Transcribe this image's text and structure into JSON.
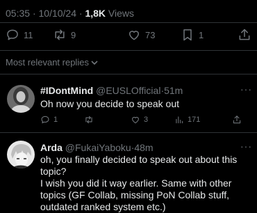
{
  "tweet": {
    "time": "05:35",
    "date": "10/10/24",
    "views_count": "1,8K",
    "views_label": "Views",
    "sep": "·",
    "actions": {
      "replies": "11",
      "reposts": "9",
      "likes": "73",
      "bookmarks": "1"
    }
  },
  "sort_label": "Most relevant replies",
  "replies": [
    {
      "name": "#IDontMind",
      "handle": "@EUSLOfficial",
      "sep": "·",
      "time": "51m",
      "more": "···",
      "text": "Oh now you decide to speak out",
      "reply_count": "1",
      "repost_count": "",
      "like_count": "3",
      "view_count": "171"
    },
    {
      "name": "Arda",
      "handle": "@FukaiYaboku",
      "sep": "·",
      "time": "48m",
      "more": "···",
      "text_lines": [
        "oh, you finally decided to speak out about this",
        "topic?",
        "I wish you did it way earlier. Same with other",
        "topics (GF Collab, missing PoN Collab stuff,",
        "outdated ranked system etc.)"
      ]
    }
  ],
  "colors": {
    "background": "#000000",
    "text": "#e7e9ea",
    "muted": "#71767b",
    "divider": "#2f3336"
  }
}
